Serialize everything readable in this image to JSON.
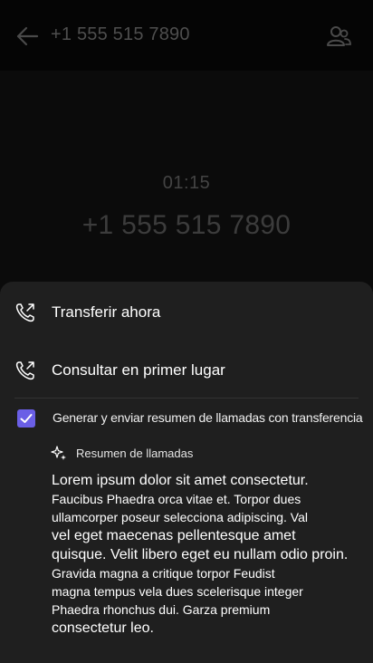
{
  "header": {
    "title": "+1 555 515 7890"
  },
  "call": {
    "timer": "01:15",
    "number": "+1 555 515 7890"
  },
  "sheet": {
    "options": [
      {
        "label": "Transferir ahora"
      },
      {
        "label": "Consultar en primer lugar"
      }
    ],
    "summary_toggle": {
      "label": "Generar y enviar resumen de llamadas con transferencia",
      "checked": true
    },
    "summary": {
      "title": "Resumen de llamadas",
      "lines": [
        "Lorem ipsum dolor sit amet consectetur.",
        "Faucibus Phaedra orca vitae et. Torpor dues",
        "ullamcorper poseur selecciona adipiscing. Val",
        "vel eget maecenas pellentesque amet",
        "quisque. Velit libero eget eu nullam odio proin.",
        "Gravida magna a critique torpor Feudist",
        "magna tempus vela dues scelerisque integer",
        "Phaedra rhonchus dui. Garza premium",
        "consectetur leo."
      ]
    }
  },
  "colors": {
    "accent": "#6a5fe6",
    "sheet_bg": "#1f1f1f",
    "background": "#0b0b0b"
  },
  "icons": [
    "arrow-left-icon",
    "people-icon",
    "phone-forward-icon",
    "sparkle-icon",
    "checkmark-icon"
  ]
}
